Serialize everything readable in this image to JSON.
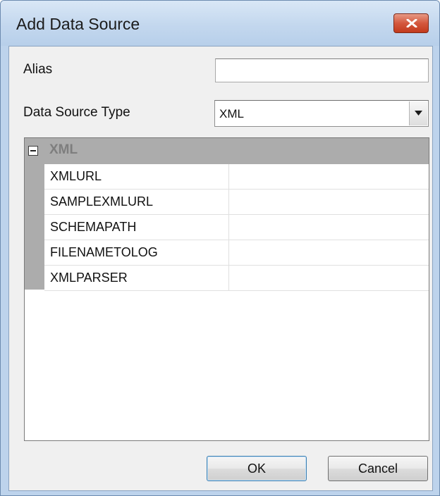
{
  "window": {
    "title": "Add Data Source",
    "close_icon": "close-x-icon"
  },
  "form": {
    "alias_label": "Alias",
    "alias_value": "",
    "type_label": "Data Source Type",
    "type_value": "XML",
    "type_arrow_icon": "dropdown-arrow-icon"
  },
  "property_grid": {
    "category": {
      "label": "XML",
      "expanded": true,
      "toggle_icon": "collapse-minus-icon"
    },
    "properties": [
      {
        "name": "XMLURL",
        "value": ""
      },
      {
        "name": "SAMPLEXMLURL",
        "value": ""
      },
      {
        "name": "SCHEMAPATH",
        "value": ""
      },
      {
        "name": "FILENAMETOLOG",
        "value": ""
      },
      {
        "name": "XMLPARSER",
        "value": ""
      }
    ]
  },
  "buttons": {
    "ok": "OK",
    "cancel": "Cancel"
  }
}
